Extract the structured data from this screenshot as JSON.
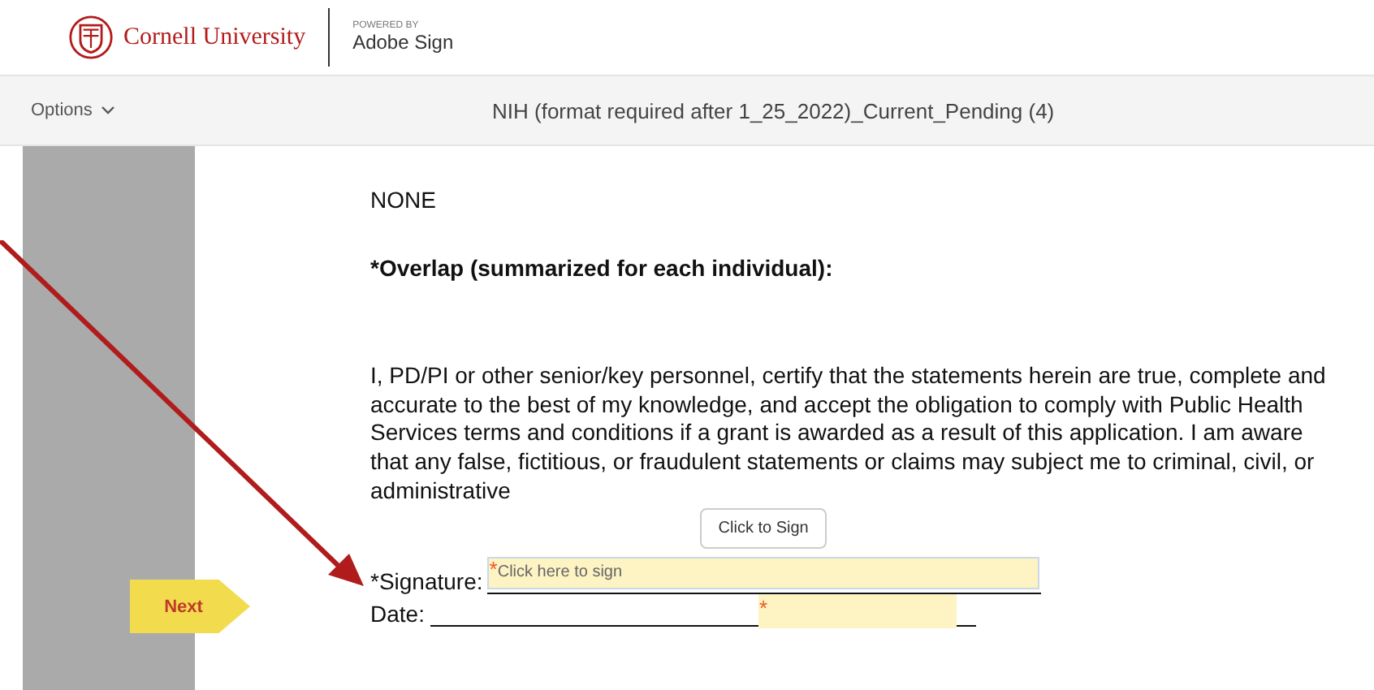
{
  "header": {
    "org": "Cornell University",
    "powered_by": "POWERED BY",
    "product": "Adobe Sign"
  },
  "toolbar": {
    "options": "Options",
    "title": "NIH (format required after 1_25_2022)_Current_Pending (4)"
  },
  "document": {
    "paragraphs": [
      {
        "kind": "plain",
        "text": "NONE"
      },
      {
        "kind": "heading",
        "text": "*Overlap (summarized for each individual):"
      },
      {
        "kind": "body",
        "text": "I, PD/PI or other senior/key personnel, certify that the statements herein are true, complete and accurate to the best of my knowledge, and accept the obligation to comply with Public Health Services terms and conditions if a grant is awarded as a result of this application. I am aware that any false, fictitious, or fraudulent statements or claims may subject me to criminal, civil, or administrative"
      }
    ],
    "signature_label": "*Signature:",
    "signature_placeholder": "Click here to sign",
    "required_mark": "*",
    "date_label": "Date:",
    "date_required_mark": "*"
  },
  "tooltip": "Click to Sign",
  "next_button": "Next"
}
